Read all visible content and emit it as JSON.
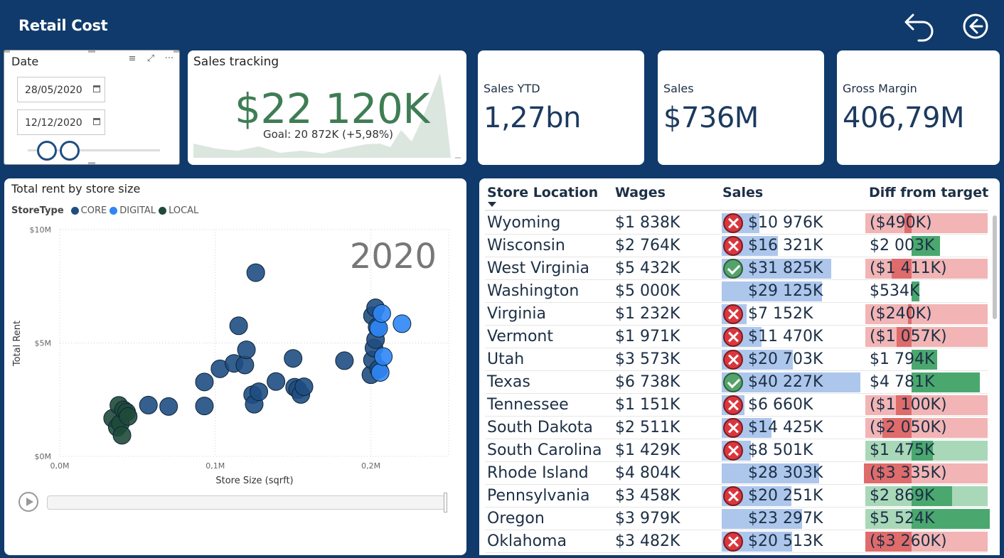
{
  "header": {
    "title": "Retail Cost",
    "undo_label": "undo-icon",
    "back_label": "back-arrow-icon"
  },
  "date_slicer": {
    "title": "Date",
    "start": "28/05/2020",
    "end": "12/12/2020",
    "icons": [
      "filter-icon",
      "focus-mode-icon",
      "more-options-icon"
    ]
  },
  "sales_tracking": {
    "title": "Sales tracking",
    "value": "$22 120K",
    "goal": "Goal: 20 872K (+5,98%)",
    "status_icon": "checkmark-icon"
  },
  "kpis": [
    {
      "label": "Sales YTD",
      "value": "1,27bn"
    },
    {
      "label": "Sales",
      "value": "$736M"
    },
    {
      "label": "Gross Margin",
      "value": "406,79M"
    }
  ],
  "colors": {
    "navy": "#0f3a6b",
    "core": "#1f4e82",
    "digital": "#2f86f6",
    "local": "#1f4a3a",
    "sales_bar": "#adc6ec",
    "neg": "#f2b4b4",
    "neg_strong": "#df6b6b",
    "pos": "#a9d8b8",
    "pos_strong": "#4aa86f",
    "kpi_green": "#3f7d54"
  },
  "scatter": {
    "title": "Total rent by store size",
    "play_axis_value": "2020",
    "legend_title": "StoreType",
    "chart_data": {
      "type": "scatter",
      "xlabel": "Store Size (sqrft)",
      "ylabel": "Total Rent",
      "xlim": [
        0,
        0.25
      ],
      "ylim": [
        0,
        10
      ],
      "x_ticks": [
        "0,0M",
        "0,1M",
        "0,2M"
      ],
      "y_ticks": [
        "$0M",
        "$5M",
        "$10M"
      ],
      "series": [
        {
          "name": "CORE",
          "color": "#1f4e82",
          "points": [
            [
              0.057,
              2.26
            ],
            [
              0.07,
              2.2
            ],
            [
              0.093,
              2.22
            ],
            [
              0.093,
              3.28
            ],
            [
              0.103,
              3.86
            ],
            [
              0.112,
              4.1
            ],
            [
              0.115,
              5.76
            ],
            [
              0.119,
              4.03
            ],
            [
              0.12,
              4.7
            ],
            [
              0.124,
              2.72
            ],
            [
              0.125,
              2.3
            ],
            [
              0.126,
              8.1
            ],
            [
              0.128,
              2.85
            ],
            [
              0.139,
              3.3
            ],
            [
              0.15,
              4.32
            ],
            [
              0.151,
              3.05
            ],
            [
              0.153,
              2.95
            ],
            [
              0.155,
              2.73
            ],
            [
              0.157,
              3.07
            ],
            [
              0.183,
              4.22
            ],
            [
              0.2,
              3.6
            ],
            [
              0.201,
              4.25
            ],
            [
              0.201,
              6.2
            ],
            [
              0.202,
              4.78
            ],
            [
              0.203,
              6.55
            ],
            [
              0.203,
              5.15
            ],
            [
              0.204,
              5.7
            ],
            [
              0.205,
              3.85
            ]
          ]
        },
        {
          "name": "DIGITAL",
          "color": "#2f86f6",
          "points": [
            [
              0.205,
              5.65
            ],
            [
              0.206,
              3.7
            ],
            [
              0.207,
              6.3
            ],
            [
              0.208,
              4.4
            ],
            [
              0.22,
              5.85
            ]
          ]
        },
        {
          "name": "LOCAL",
          "color": "#1f4a3a",
          "points": [
            [
              0.034,
              1.68
            ],
            [
              0.037,
              1.28
            ],
            [
              0.038,
              2.25
            ],
            [
              0.039,
              1.45
            ],
            [
              0.04,
              0.93
            ],
            [
              0.041,
              2.05
            ],
            [
              0.043,
              1.95
            ],
            [
              0.044,
              1.76
            ]
          ]
        }
      ]
    }
  },
  "table": {
    "columns": [
      "Store Location",
      "Wages",
      "Sales",
      "Diff from target"
    ],
    "rows": [
      {
        "location": "Wyoming",
        "wages": "$1 838K",
        "sales": "$10 976K",
        "sales_value": 10976,
        "status": "bad",
        "diff": "($490K)",
        "diff_value": -490
      },
      {
        "location": "Wisconsin",
        "wages": "$2 764K",
        "sales": "$16 321K",
        "sales_value": 16321,
        "status": "bad",
        "diff": "$2 003K",
        "diff_value": 2003
      },
      {
        "location": "West Virginia",
        "wages": "$5 432K",
        "sales": "$31 825K",
        "sales_value": 31825,
        "status": "good",
        "diff": "($1 411K)",
        "diff_value": -1411
      },
      {
        "location": "Washington",
        "wages": "$5 000K",
        "sales": "$29 125K",
        "sales_value": 29125,
        "status": "none",
        "diff": "$534K",
        "diff_value": 534
      },
      {
        "location": "Virginia",
        "wages": "$1 232K",
        "sales": "$7 152K",
        "sales_value": 7152,
        "status": "bad",
        "diff": "($240K)",
        "diff_value": -240
      },
      {
        "location": "Vermont",
        "wages": "$1 971K",
        "sales": "$11 470K",
        "sales_value": 11470,
        "status": "bad",
        "diff": "($1 057K)",
        "diff_value": -1057
      },
      {
        "location": "Utah",
        "wages": "$3 573K",
        "sales": "$20 703K",
        "sales_value": 20703,
        "status": "bad",
        "diff": "$1 794K",
        "diff_value": 1794
      },
      {
        "location": "Texas",
        "wages": "$6 738K",
        "sales": "$40 227K",
        "sales_value": 40227,
        "status": "good",
        "diff": "$4 781K",
        "diff_value": 4781
      },
      {
        "location": "Tennessee",
        "wages": "$1 151K",
        "sales": "$6 660K",
        "sales_value": 6660,
        "status": "bad",
        "diff": "($1 100K)",
        "diff_value": -1100
      },
      {
        "location": "South Dakota",
        "wages": "$2 511K",
        "sales": "$14 425K",
        "sales_value": 14425,
        "status": "bad",
        "diff": "($2 050K)",
        "diff_value": -2050
      },
      {
        "location": "South Carolina",
        "wages": "$1 429K",
        "sales": "$8 501K",
        "sales_value": 8501,
        "status": "bad",
        "diff": "$1 475K",
        "diff_value": 1475
      },
      {
        "location": "Rhode Island",
        "wages": "$4 804K",
        "sales": "$28 303K",
        "sales_value": 28303,
        "status": "none",
        "diff": "($3 335K)",
        "diff_value": -3335
      },
      {
        "location": "Pennsylvania",
        "wages": "$3 458K",
        "sales": "$20 251K",
        "sales_value": 20251,
        "status": "bad",
        "diff": "$2 869K",
        "diff_value": 2869
      },
      {
        "location": "Oregon",
        "wages": "$3 979K",
        "sales": "$23 297K",
        "sales_value": 23297,
        "status": "none",
        "diff": "$5 524K",
        "diff_value": 5524
      },
      {
        "location": "Oklahoma",
        "wages": "$3 482K",
        "sales": "$20 513K",
        "sales_value": 20513,
        "status": "bad",
        "diff": "($3 260K)",
        "diff_value": -3260
      }
    ]
  }
}
